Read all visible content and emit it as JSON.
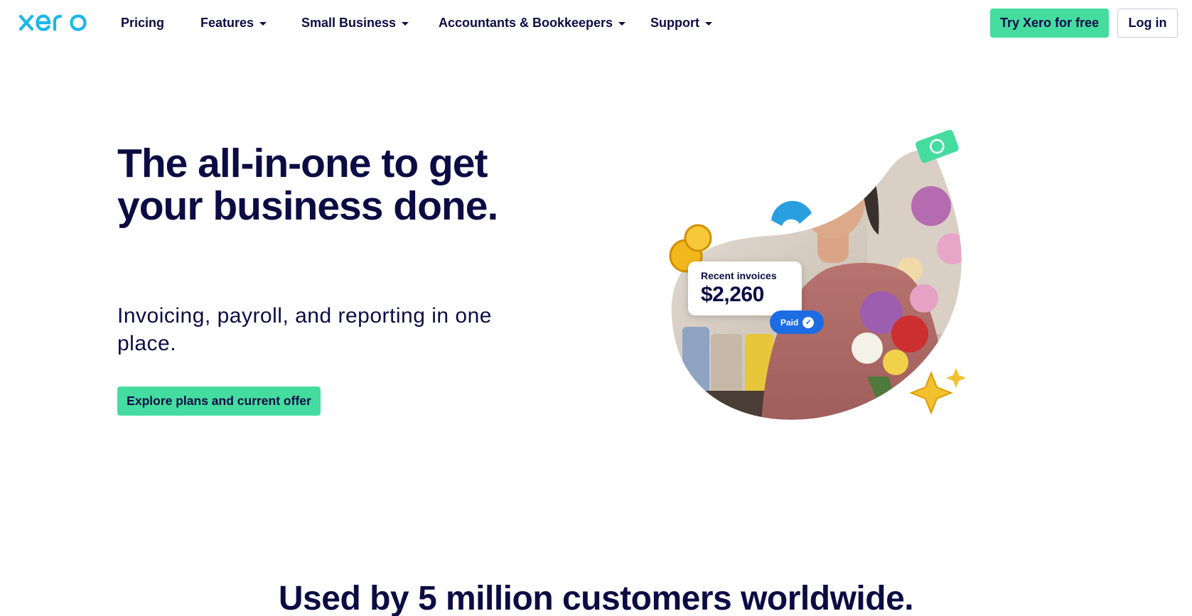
{
  "brand": {
    "name": "xero",
    "accent": "#19b7e8",
    "cta_color": "#45dca0",
    "text_color": "#0c0c44"
  },
  "nav": {
    "items": [
      {
        "label": "Pricing",
        "has_menu": false
      },
      {
        "label": "Features",
        "has_menu": true
      },
      {
        "label": "Small Business",
        "has_menu": true
      },
      {
        "label": "Accountants & Bookkeepers",
        "has_menu": true
      },
      {
        "label": "Support",
        "has_menu": true
      }
    ],
    "try_label": "Try Xero for free",
    "login_label": "Log in"
  },
  "hero": {
    "title": "The all-in-one to get your business done.",
    "subtitle": "Invoicing, payroll, and reporting in one place.",
    "cta_label": "Explore plans and current offer",
    "card": {
      "label": "Recent invoices",
      "amount": "$2,260",
      "status": "Paid"
    }
  },
  "customers": {
    "title": "Used by 5 million customers worldwide."
  }
}
